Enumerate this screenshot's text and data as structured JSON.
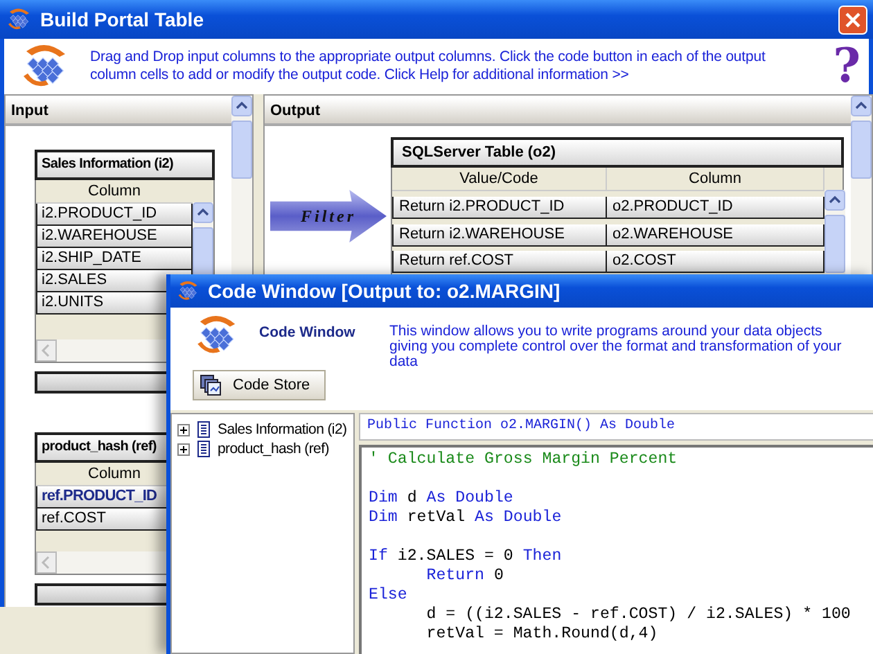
{
  "window": {
    "title": "Build Portal Table"
  },
  "header": {
    "description": "Drag and Drop input columns to the appropriate output columns.  Click the code button in each of the output column cells to add or modify the output code.  Click Help for additional information >>",
    "help_glyph": "?"
  },
  "input_panel": {
    "title": "Input",
    "tables": [
      {
        "title": "Sales Information (i2)",
        "column_header": "Column",
        "rows": [
          {
            "name": "i2.PRODUCT_ID",
            "key": false
          },
          {
            "name": "i2.WAREHOUSE",
            "key": false
          },
          {
            "name": "i2.SHIP_DATE",
            "key": false
          },
          {
            "name": "i2.SALES",
            "key": false
          },
          {
            "name": "i2.UNITS",
            "key": false
          }
        ]
      },
      {
        "title": "product_hash (ref)",
        "column_header": "Column",
        "rows": [
          {
            "name": "ref.PRODUCT_ID",
            "key": true
          },
          {
            "name": "ref.COST",
            "key": false
          }
        ]
      }
    ]
  },
  "output_panel": {
    "title": "Output",
    "filter_label": "Filter",
    "table": {
      "title": "SQLServer Table (o2)",
      "columns": [
        "Value/Code",
        "Column"
      ],
      "rows": [
        [
          "Return i2.PRODUCT_ID",
          "o2.PRODUCT_ID"
        ],
        [
          "Return i2.WAREHOUSE",
          "o2.WAREHOUSE"
        ],
        [
          "Return ref.COST",
          "o2.COST"
        ]
      ]
    }
  },
  "code_window": {
    "title": "Code Window [Output to: o2.MARGIN]",
    "heading": "Code Window",
    "description": "This window allows you to write programs around your data objects giving you complete control over the format and transformation of your data",
    "code_store_button": "Code Store",
    "tree": [
      {
        "label": "Sales Information (i2)",
        "expanded": false
      },
      {
        "label": "product_hash (ref)",
        "expanded": false
      }
    ],
    "signature": "Public Function o2.MARGIN() As Double",
    "code_lines": [
      {
        "kind": "comment",
        "indented": false,
        "tokens": [
          {
            "text": "' Calculate Gross Margin Percent",
            "keyword": false
          }
        ]
      },
      {
        "kind": "blank"
      },
      {
        "kind": "code",
        "indented": false,
        "tokens": [
          {
            "text": "Dim",
            "keyword": true
          },
          {
            "text": " d ",
            "keyword": false
          },
          {
            "text": "As Double",
            "keyword": true
          }
        ]
      },
      {
        "kind": "code",
        "indented": false,
        "tokens": [
          {
            "text": "Dim",
            "keyword": true
          },
          {
            "text": " retVal ",
            "keyword": false
          },
          {
            "text": "As Double",
            "keyword": true
          }
        ]
      },
      {
        "kind": "blank"
      },
      {
        "kind": "code",
        "indented": false,
        "tokens": [
          {
            "text": "If",
            "keyword": true
          },
          {
            "text": " i2.SALES = 0 ",
            "keyword": false
          },
          {
            "text": "Then",
            "keyword": true
          }
        ]
      },
      {
        "kind": "code",
        "indented": true,
        "tokens": [
          {
            "text": "Return",
            "keyword": true
          },
          {
            "text": " 0",
            "keyword": false
          }
        ]
      },
      {
        "kind": "code",
        "indented": false,
        "tokens": [
          {
            "text": "Else",
            "keyword": true
          }
        ]
      },
      {
        "kind": "code",
        "indented": true,
        "tokens": [
          {
            "text": "d = ((i2.SALES - ref.COST) / i2.SALES) * 100",
            "keyword": false
          }
        ]
      },
      {
        "kind": "code",
        "indented": true,
        "tokens": [
          {
            "text": "retVal = Math.Round(d,4)",
            "keyword": false
          }
        ]
      }
    ]
  }
}
